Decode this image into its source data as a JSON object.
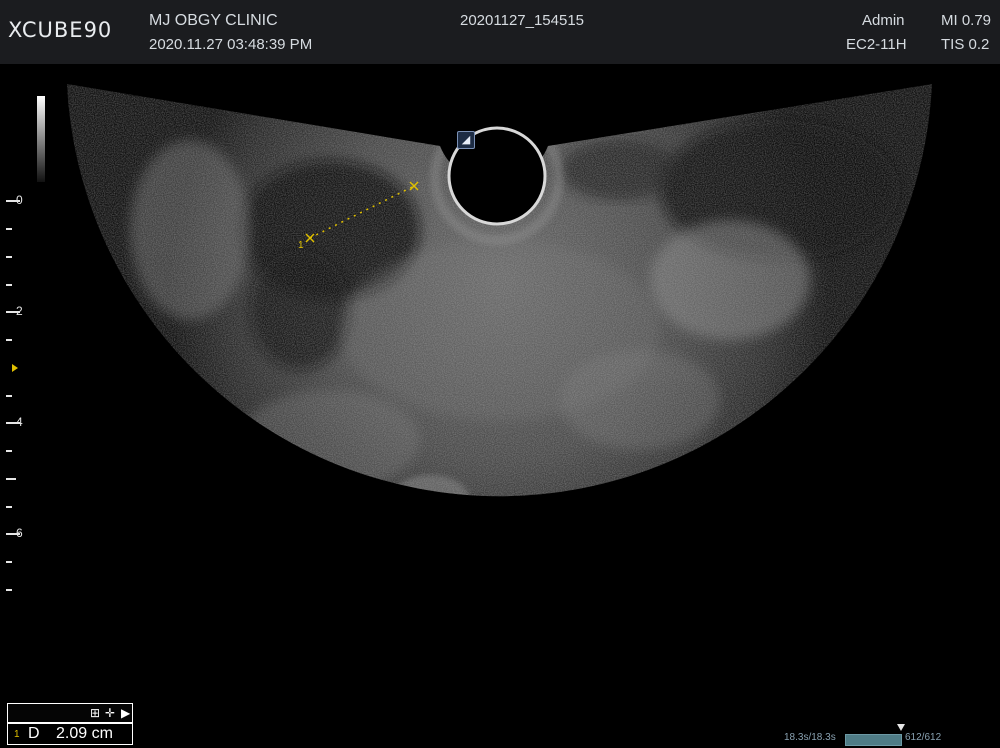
{
  "header": {
    "logo": "XCUBE90",
    "clinic": "MJ OBGY CLINIC",
    "datetime": "2020.11.27  03:48:39 PM",
    "file_id": "20201127_154515",
    "user": "Admin",
    "probe": "EC2-11H",
    "mi": "MI 0.79",
    "tis": "TIS 0.2"
  },
  "depth_scale": {
    "labels": [
      "0",
      "2",
      "4",
      "6"
    ]
  },
  "orientation_marker": "◢",
  "measurement": {
    "index": "1",
    "caliper_label": "1",
    "label": "D",
    "value": "2.09 cm",
    "tools": [
      "⊞",
      "✛",
      "▶"
    ]
  },
  "cine": {
    "time": "18.3s/18.3s",
    "frames": "612/612",
    "progress": 1.0
  },
  "colors": {
    "header_bg": "#1b1c1f",
    "caliper": "#e0c000",
    "cine_bar": "#4f7c86"
  }
}
